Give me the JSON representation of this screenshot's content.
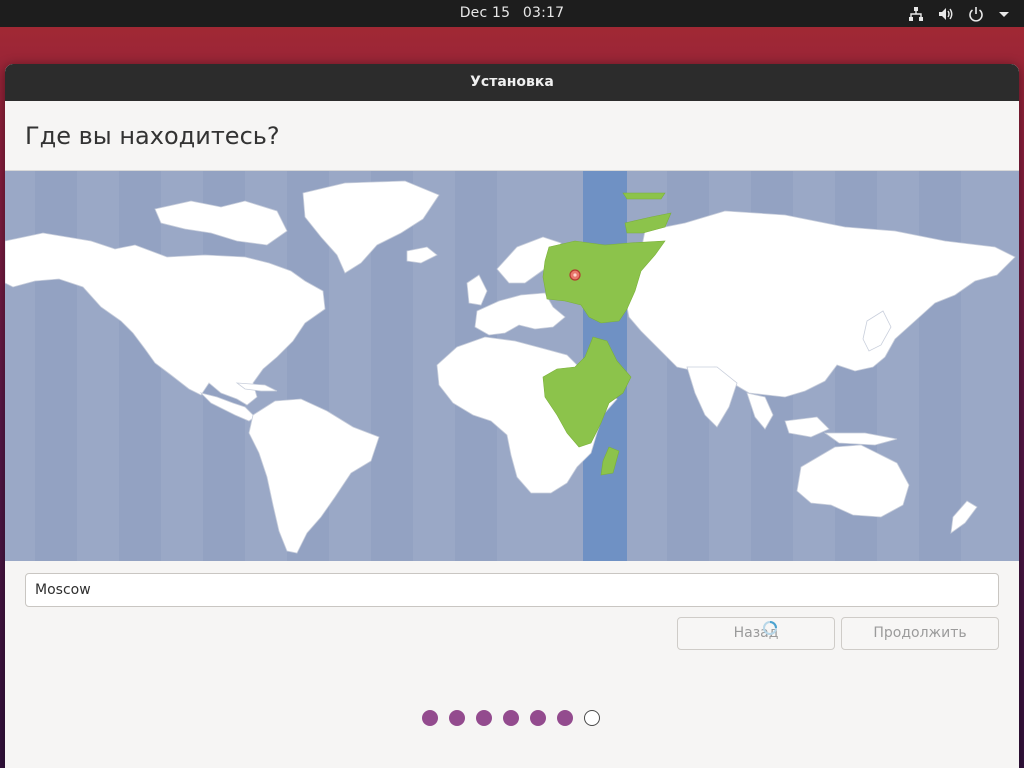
{
  "topbar": {
    "date": "Dec 15",
    "time": "03:17",
    "icons": [
      "network-icon",
      "volume-icon",
      "power-icon",
      "menu-arrow-icon"
    ]
  },
  "window": {
    "title": "Установка"
  },
  "page": {
    "heading": "Где вы находитесь?"
  },
  "map": {
    "selected_city": "Moscow",
    "highlight_color": "#8cc34b",
    "ocean_color": "#9aa8c6",
    "timezone_band_color": "#6f91c4"
  },
  "search": {
    "value": "Moscow"
  },
  "buttons": {
    "back_label": "Назад",
    "continue_label": "Продолжить"
  },
  "progress": {
    "total_steps": 7,
    "completed_steps": 6
  },
  "colors": {
    "accent": "#934b8e",
    "titlebar": "#2c2c2c",
    "background": "#f6f5f4"
  }
}
